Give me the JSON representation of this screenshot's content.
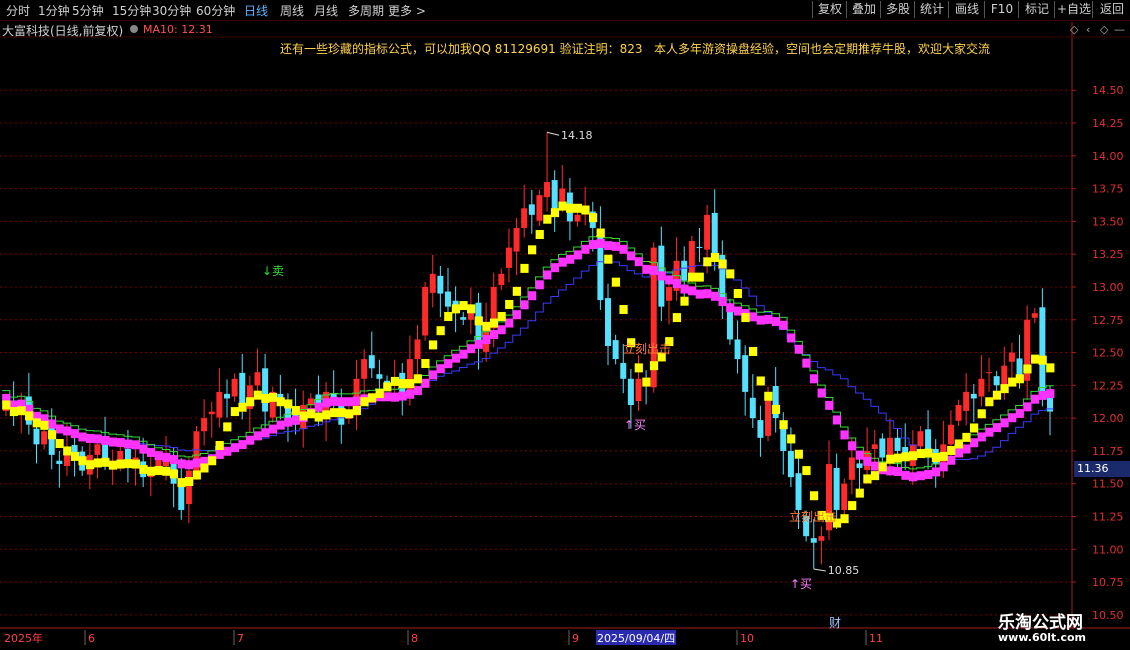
{
  "toolbar": {
    "periods": [
      "分时",
      "1分钟",
      "5分钟",
      "15分钟",
      "30分钟",
      "60分钟",
      "日线",
      "周线",
      "月线",
      "多周期",
      "更多 >"
    ],
    "active_period": "日线",
    "right_buttons": [
      "复权",
      "叠加",
      "多股",
      "统计",
      "画线",
      "F10",
      "标记",
      "+自选",
      "返回"
    ]
  },
  "info": {
    "security": "大富科技(日线,前复权)",
    "ma_label": "MA10: 12.31"
  },
  "notice": {
    "left": "还有一些珍藏的指标公式，可以加我QQ 81129691 验证注明：823",
    "right": "本人多年游资操盘经验，空间也会定期推荐牛股，欢迎大家交流"
  },
  "price_tag": "11.36",
  "watermark": {
    "name": "乐淘公式网",
    "url": "www.60lt.com"
  },
  "colors": {
    "up": "#ff2a2a",
    "down": "#54e0ff",
    "grid": "#7a0000",
    "axis": "#a02020",
    "yellow": "#ffff00",
    "magenta": "#ff33ff",
    "blue": "#3a3aff",
    "green": "#33dd33",
    "signal": "#ff6a2a",
    "buy": "#ff80ff"
  },
  "chart_data": {
    "type": "candlestick",
    "ylim": [
      10.4,
      14.7
    ],
    "yticks": [
      10.5,
      10.75,
      11.0,
      11.25,
      11.5,
      11.75,
      12.0,
      12.25,
      12.5,
      12.75,
      13.0,
      13.25,
      13.5,
      13.75,
      14.0,
      14.25,
      14.5
    ],
    "x_labels": [
      "2025年",
      "6",
      "7",
      "8",
      "9",
      "2025/09/04/四",
      "10",
      "11"
    ],
    "highlight_date": "2025/09/04/四",
    "close_series": [
      12.15,
      12.05,
      12.12,
      11.95,
      11.8,
      11.9,
      11.72,
      11.65,
      11.78,
      11.7,
      11.6,
      11.72,
      11.8,
      11.68,
      11.65,
      11.75,
      11.62,
      11.7,
      11.55,
      11.6,
      11.68,
      11.72,
      11.5,
      11.3,
      11.6,
      11.9,
      12.0,
      12.05,
      12.2,
      12.15,
      12.3,
      12.1,
      12.25,
      12.35,
      12.05,
      12.2,
      12.1,
      12.0,
      11.95,
      12.1,
      12.15,
      12.05,
      12.2,
      12.1,
      11.95,
      12.05,
      12.3,
      12.45,
      12.38,
      12.3,
      12.25,
      12.3,
      12.2,
      12.45,
      12.6,
      13.0,
      13.1,
      12.95,
      12.85,
      12.8,
      12.75,
      12.85,
      12.55,
      12.7,
      13.0,
      13.1,
      13.3,
      13.45,
      13.6,
      13.55,
      13.7,
      13.8,
      13.6,
      13.75,
      13.5,
      13.55,
      13.62,
      13.45,
      12.9,
      12.55,
      12.45,
      12.3,
      12.1,
      12.3,
      12.25,
      13.3,
      12.85,
      13.0,
      13.2,
      13.05,
      13.35,
      13.3,
      13.55,
      13.2,
      12.9,
      12.6,
      12.45,
      12.2,
      12.0,
      11.85,
      12.2,
      12.0,
      11.75,
      11.55,
      11.3,
      11.1,
      11.05,
      11.1,
      11.65,
      11.3,
      11.5,
      11.7,
      11.62,
      11.75,
      11.8,
      11.7,
      11.85,
      11.75,
      11.68,
      11.8,
      11.9,
      11.72,
      11.65,
      11.8,
      11.95,
      12.1,
      12.2,
      12.15,
      12.3,
      12.35,
      12.25,
      12.4,
      12.5,
      12.3,
      12.75,
      12.8,
      12.2,
      12.05
    ],
    "high_price": 14.18,
    "low_price": 10.85,
    "annotations": [
      {
        "text": "↓卖",
        "x": 270,
        "y": 271,
        "color": "#33dd33"
      },
      {
        "text": "立刻出击",
        "x": 631,
        "y": 349,
        "color": "#ff7a3a"
      },
      {
        "text": "↑买",
        "x": 632,
        "y": 425,
        "color": "#ff80ff"
      },
      {
        "text": "立刻出击",
        "x": 797,
        "y": 517,
        "color": "#ff7a3a"
      },
      {
        "text": "↑买",
        "x": 798,
        "y": 584,
        "color": "#ff80ff"
      },
      {
        "text": "财",
        "x": 837,
        "y": 623,
        "color": "#a0c8ff"
      }
    ]
  }
}
